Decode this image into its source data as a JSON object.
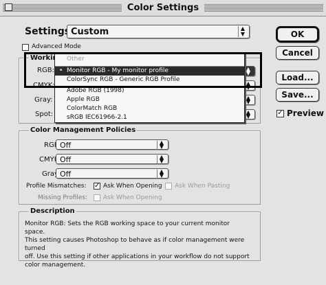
{
  "window": {
    "title": "Color Settings"
  },
  "settings": {
    "label": "Settings:",
    "value": "Custom"
  },
  "advanced_mode": {
    "label": "Advanced Mode",
    "checked": false
  },
  "working_spaces": {
    "title": "Working Spaces",
    "rgb_label": "RGB:",
    "cmyk_label": "CMYK:",
    "gray_label": "Gray:",
    "spot_label": "Spot:"
  },
  "rgb_menu": {
    "items": [
      {
        "label": "Other",
        "state": "disabled"
      },
      {
        "label": "Monitor RGB - My monitor profile",
        "state": "selected"
      },
      {
        "label": "ColorSync RGB - Generic RGB Profile",
        "state": "normal"
      },
      {
        "label": "Adobe RGB (1998)",
        "state": "normal"
      },
      {
        "label": "Apple RGB",
        "state": "normal"
      },
      {
        "label": "ColorMatch RGB",
        "state": "normal"
      },
      {
        "label": "sRGB IEC61966-2.1",
        "state": "normal"
      }
    ]
  },
  "policies": {
    "title": "Color Management Policies",
    "rgb": {
      "label": "RGB:",
      "value": "Off"
    },
    "cmyk": {
      "label": "CMYK:",
      "value": "Off"
    },
    "gray": {
      "label": "Gray:",
      "value": "Off"
    },
    "profile_mismatches": {
      "label": "Profile Mismatches:",
      "ask_opening": "Ask When Opening",
      "ask_opening_checked": true,
      "ask_pasting": "Ask When Pasting",
      "ask_pasting_checked": false
    },
    "missing_profiles": {
      "label": "Missing Profiles:",
      "ask_opening": "Ask When Opening",
      "ask_opening_checked": false
    }
  },
  "description": {
    "title": "Description",
    "lines": [
      "Monitor RGB:  Sets the RGB working space to your current monitor space.",
      "This setting causes Photoshop to behave as if color management were turned",
      "off.  Use this setting if other applications in your workflow do not support",
      "color management."
    ]
  },
  "buttons": {
    "ok": "OK",
    "cancel": "Cancel",
    "load": "Load...",
    "save": "Save..."
  },
  "preview": {
    "label": "Preview",
    "checked": true
  }
}
